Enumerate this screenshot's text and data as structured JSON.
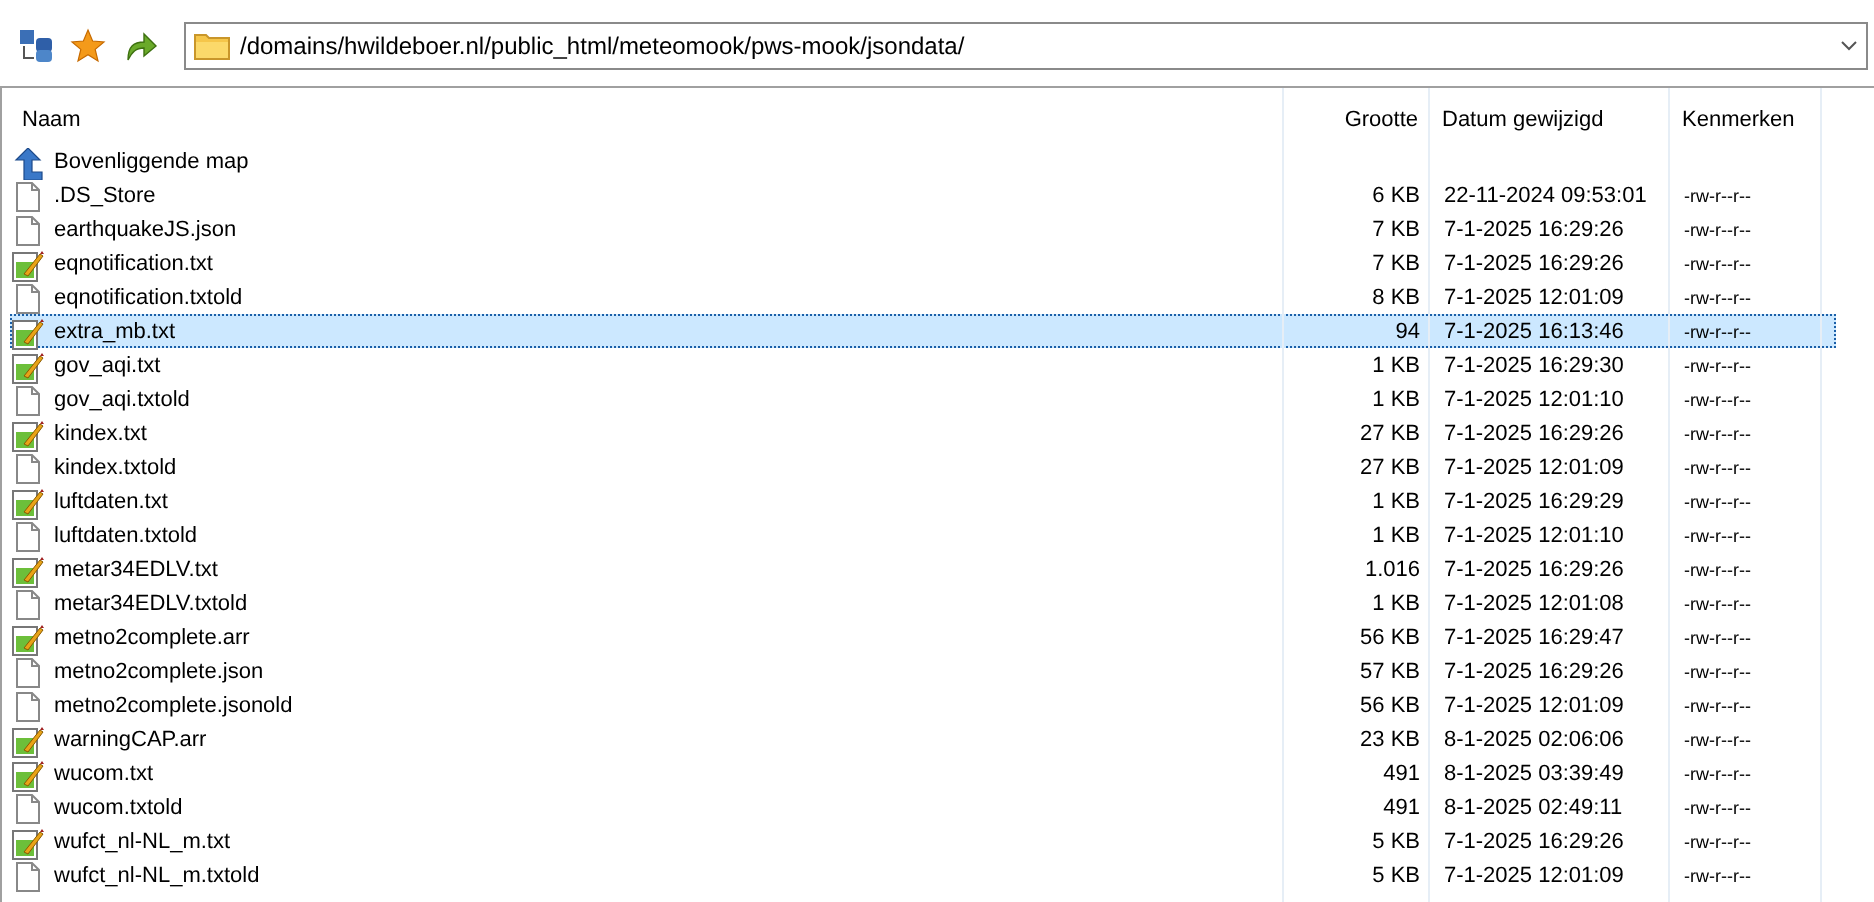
{
  "toolbar": {
    "path": "/domains/hwildeboer.nl/public_html/meteomook/pws-mook/jsondata/"
  },
  "table": {
    "columns": [
      "Naam",
      "Grootte",
      "Datum gewijzigd",
      "Kenmerken"
    ],
    "rows": [
      {
        "kind": "parent",
        "name": "Bovenliggende map",
        "selected": false
      },
      {
        "kind": "plain",
        "name": ".DS_Store",
        "size": "6 KB",
        "date": "22-11-2024 09:53:01",
        "attrs": "-rw-r--r--",
        "selected": false
      },
      {
        "kind": "plain",
        "name": "earthquakeJS.json",
        "size": "7 KB",
        "date": "7-1-2025 16:29:26",
        "attrs": "-rw-r--r--",
        "selected": false
      },
      {
        "kind": "text",
        "name": "eqnotification.txt",
        "size": "7 KB",
        "date": "7-1-2025 16:29:26",
        "attrs": "-rw-r--r--",
        "selected": false
      },
      {
        "kind": "plain",
        "name": "eqnotification.txtold",
        "size": "8 KB",
        "date": "7-1-2025 12:01:09",
        "attrs": "-rw-r--r--",
        "selected": false
      },
      {
        "kind": "text",
        "name": "extra_mb.txt",
        "size": "94",
        "date": "7-1-2025 16:13:46",
        "attrs": "-rw-r--r--",
        "selected": true
      },
      {
        "kind": "text",
        "name": "gov_aqi.txt",
        "size": "1 KB",
        "date": "7-1-2025 16:29:30",
        "attrs": "-rw-r--r--",
        "selected": false
      },
      {
        "kind": "plain",
        "name": "gov_aqi.txtold",
        "size": "1 KB",
        "date": "7-1-2025 12:01:10",
        "attrs": "-rw-r--r--",
        "selected": false
      },
      {
        "kind": "text",
        "name": "kindex.txt",
        "size": "27 KB",
        "date": "7-1-2025 16:29:26",
        "attrs": "-rw-r--r--",
        "selected": false
      },
      {
        "kind": "plain",
        "name": "kindex.txtold",
        "size": "27 KB",
        "date": "7-1-2025 12:01:09",
        "attrs": "-rw-r--r--",
        "selected": false
      },
      {
        "kind": "text",
        "name": "luftdaten.txt",
        "size": "1 KB",
        "date": "7-1-2025 16:29:29",
        "attrs": "-rw-r--r--",
        "selected": false
      },
      {
        "kind": "plain",
        "name": "luftdaten.txtold",
        "size": "1 KB",
        "date": "7-1-2025 12:01:10",
        "attrs": "-rw-r--r--",
        "selected": false
      },
      {
        "kind": "text",
        "name": "metar34EDLV.txt",
        "size": "1.016",
        "date": "7-1-2025 16:29:26",
        "attrs": "-rw-r--r--",
        "selected": false
      },
      {
        "kind": "plain",
        "name": "metar34EDLV.txtold",
        "size": "1 KB",
        "date": "7-1-2025 12:01:08",
        "attrs": "-rw-r--r--",
        "selected": false
      },
      {
        "kind": "text",
        "name": "metno2complete.arr",
        "size": "56 KB",
        "date": "7-1-2025 16:29:47",
        "attrs": "-rw-r--r--",
        "selected": false
      },
      {
        "kind": "plain",
        "name": "metno2complete.json",
        "size": "57 KB",
        "date": "7-1-2025 16:29:26",
        "attrs": "-rw-r--r--",
        "selected": false
      },
      {
        "kind": "plain",
        "name": "metno2complete.jsonold",
        "size": "56 KB",
        "date": "7-1-2025 12:01:09",
        "attrs": "-rw-r--r--",
        "selected": false
      },
      {
        "kind": "text",
        "name": "warningCAP.arr",
        "size": "23 KB",
        "date": "8-1-2025 02:06:06",
        "attrs": "-rw-r--r--",
        "selected": false
      },
      {
        "kind": "text",
        "name": "wucom.txt",
        "size": "491",
        "date": "8-1-2025 03:39:49",
        "attrs": "-rw-r--r--",
        "selected": false
      },
      {
        "kind": "plain",
        "name": "wucom.txtold",
        "size": "491",
        "date": "8-1-2025 02:49:11",
        "attrs": "-rw-r--r--",
        "selected": false
      },
      {
        "kind": "text",
        "name": "wufct_nl-NL_m.txt",
        "size": "5 KB",
        "date": "7-1-2025 16:29:26",
        "attrs": "-rw-r--r--",
        "selected": false
      },
      {
        "kind": "plain",
        "name": "wufct_nl-NL_m.txtold",
        "size": "5 KB",
        "date": "7-1-2025 12:01:09",
        "attrs": "-rw-r--r--",
        "selected": false
      }
    ]
  }
}
